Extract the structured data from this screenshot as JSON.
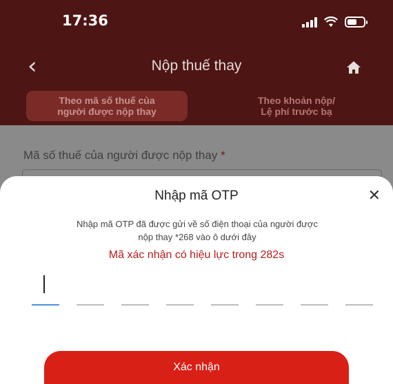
{
  "status_bar": {
    "time": "17:36",
    "battery_level": 0.6
  },
  "header": {
    "title": "Nộp thuế thay",
    "back_icon": "chevron-left-icon",
    "home_icon": "home-icon"
  },
  "tabs": [
    {
      "label_line1": "Theo mã số thuế của",
      "label_line2": "người được nộp thay",
      "active": true
    },
    {
      "label_line1": "Theo khoản nộp/",
      "label_line2": "Lệ phí trước bạ",
      "active": false
    }
  ],
  "form": {
    "taxcode_label": "Mã số thuế của người được nộp thay",
    "required_mark": "*"
  },
  "otp_sheet": {
    "title": "Nhập mã OTP",
    "close_icon": "close-icon",
    "description_line1": "Nhập mã OTP đã được gửi về số điện thoại của người được",
    "description_line2": "nộp thay *268 vào ô dưới đây",
    "countdown": "Mã xác nhận có hiệu lực trong 282s",
    "digit_count": 8,
    "confirm_label": "Xác nhận"
  },
  "colors": {
    "header_bg": "#4d1513",
    "accent_red": "#d82017",
    "countdown_red": "#b81c1c",
    "active_underline": "#4a8ee0"
  }
}
